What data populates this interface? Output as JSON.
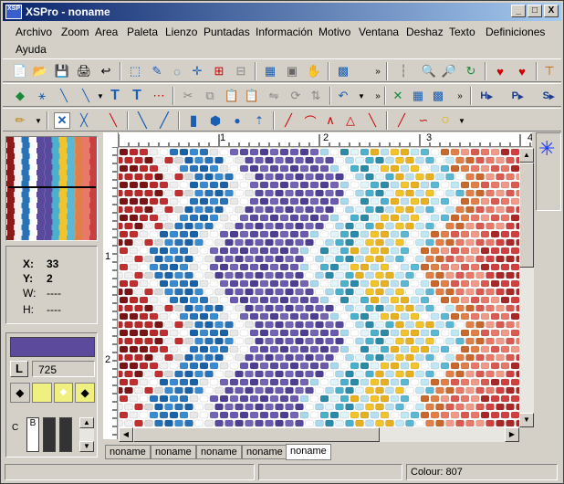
{
  "window": {
    "title": "XSPro - noname",
    "icon_text": "XSP",
    "minimize": "_",
    "maximize": "□",
    "close": "X"
  },
  "menu": [
    "Archivo",
    "Zoom",
    "Area",
    "Paleta",
    "Lienzo",
    "Puntadas",
    "Información",
    "Motivo",
    "Ventana",
    "Deshaz",
    "Texto",
    "Definiciones",
    "Ayuda"
  ],
  "toolbar3_labels": {
    "h_stitch": "H",
    "p_stitch": "P",
    "s_stitch": "S"
  },
  "coords": {
    "x_label": "X:",
    "x_value": "33",
    "y_label": "Y:",
    "y_value": "2",
    "w_label": "W:",
    "w_value": "----",
    "h_label": "H:",
    "h_value": "----"
  },
  "palette": {
    "current_color": "#5c4a9c",
    "color_number": "725",
    "l_label": "L",
    "c_label": "C",
    "b_label": "B"
  },
  "ruler": {
    "h_marks": [
      "1",
      "2",
      "3",
      "4"
    ],
    "v_marks": [
      "1",
      "2"
    ]
  },
  "tabs": [
    "noname",
    "noname",
    "noname",
    "noname",
    "noname"
  ],
  "active_tab": 4,
  "status": {
    "left": "",
    "middle": "",
    "colour": "Colour: 807"
  },
  "stitch_pattern": [
    "#8b1a1a",
    "#c0392b",
    "#f5f5f5",
    "#e0e0e0",
    "#1e6fb0",
    "#3b8fd0",
    "#f0f0f0",
    "#ffffff",
    "#6b5aa8",
    "#5848a0",
    "#4a3c90",
    "#7b6cb8",
    "#5a4a9e",
    "#6a5ab0",
    "#b8e0f0",
    "#5bb8d0",
    "#2e8aa8",
    "#e0f4fa",
    "#f5c830",
    "#f5d040",
    "#e0f0f8",
    "#6ac0d8",
    "#ffffff",
    "#c85a28",
    "#e07048",
    "#f09078",
    "#e06860",
    "#d05048",
    "#f5a090",
    "#b03030"
  ]
}
